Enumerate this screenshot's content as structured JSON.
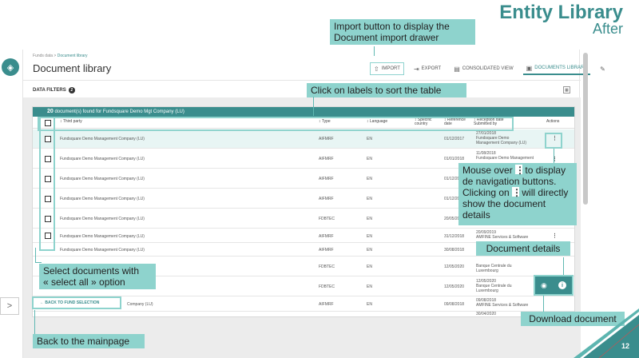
{
  "slide": {
    "title": "Entity Library",
    "subtitle": "After",
    "page_number": "12"
  },
  "app": {
    "breadcrumb": {
      "root": "Funds data",
      "separator": ">",
      "current": "Document library"
    },
    "page_title": "Document library",
    "toolbar": {
      "import": "IMPORT",
      "export": "EXPORT",
      "consolidated": "CONSOLIDATED VIEW",
      "documents_library": "DOCUMENTS LIBRARY"
    },
    "filters": {
      "label": "DATA FILTERS",
      "count": "2"
    },
    "table": {
      "summary_count": "20",
      "summary_text": "document(s) found for Fundsquare Demo Mgt Company (LU)",
      "headers": {
        "third_party": "Third party",
        "type": "Type",
        "language": "Language",
        "specific_country": "Specific country",
        "reference_date": "Reference date",
        "reception_date": "Reception date Submitted by",
        "actions": "Actions"
      },
      "rows": [
        {
          "third_party": "Fundsquare Demo Management Company (LU)",
          "type": "AIFMRF",
          "language": "EN",
          "ref_date": "01/12/2017",
          "reception": "27/01/2018",
          "submitter": "Fundsquare Demo Management Company (LU)"
        },
        {
          "third_party": "Fundsquare Demo Management Company (LU)",
          "type": "AIFMRF",
          "language": "EN",
          "ref_date": "01/01/2018",
          "reception": "11/08/2018",
          "submitter": "Fundsquare Demo Management"
        },
        {
          "third_party": "Fundsquare Demo Management Company (LU)",
          "type": "AIFMRF",
          "language": "EN",
          "ref_date": "01/12/20",
          "reception": "",
          "submitter": ""
        },
        {
          "third_party": "Fundsquare Demo Management Company (LU)",
          "type": "AIFMRF",
          "language": "EN",
          "ref_date": "01/12/20",
          "reception": "",
          "submitter": ""
        },
        {
          "third_party": "Fundsquare Demo Management Company (LU)",
          "type": "FDBTEC",
          "language": "EN",
          "ref_date": "20/05/20",
          "reception": "",
          "submitter": ""
        },
        {
          "third_party": "Fundsquare Demo Management Company (LU)",
          "type": "AIFMRF",
          "language": "EN",
          "ref_date": "31/12/2018",
          "reception": "20/09/2019",
          "submitter": "AMFINE Services & Software"
        },
        {
          "third_party": "Fundsquare Demo Management Company (LU)",
          "type": "AIFMRF",
          "language": "EN",
          "ref_date": "30/08/2018",
          "reception": "",
          "submitter": ""
        },
        {
          "third_party": "Fundsquare Demo Management Company (LU)",
          "type": "FDBTEC",
          "language": "EN",
          "ref_date": "12/05/2020",
          "reception": "",
          "submitter": "Banque Centrale du Luxembourg"
        },
        {
          "third_party": "Fundsquare Demo Management Company (LU)",
          "type": "FDBTEC",
          "language": "EN",
          "ref_date": "12/05/2020",
          "reception": "12/05/2020",
          "submitter": "Banque Centrale du Luxembourg"
        },
        {
          "third_party": "Fundsquare Demo Management Company (LU)",
          "type": "AIFMRF",
          "language": "EN",
          "ref_date": "09/08/2018",
          "reception": "09/08/2018",
          "submitter": "AMFINE Services & Software"
        }
      ],
      "last_reception": "30/04/2020"
    },
    "back_button": "BACK TO FUND SELECTION"
  },
  "callouts": {
    "import": "Import button to display the Document import drawer",
    "sort": "Click on labels to sort the table",
    "mouse_over_1": "Mouse over",
    "mouse_over_2": "to display de navigation buttons. Clicking on",
    "mouse_over_3": "will directly show the document details",
    "select_all_1": "Select documents with",
    "select_all_2": "« select all » option",
    "doc_details": "Document details",
    "download": "Download document",
    "back": "Back to the mainpage"
  },
  "icons": {
    "eye": "eye-icon",
    "info": "info-icon",
    "kebab": "kebab-icon"
  },
  "colors": {
    "accent": "#3a8d8d",
    "callout": "#8ed3cd"
  }
}
